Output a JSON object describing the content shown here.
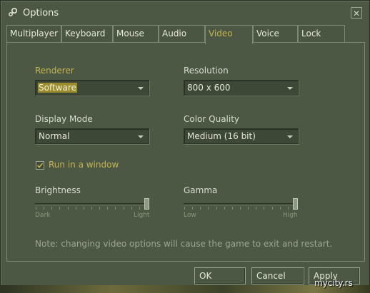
{
  "window": {
    "title": "Options",
    "close_glyph": "✕"
  },
  "tabs": [
    {
      "label": "Multiplayer",
      "active": false
    },
    {
      "label": "Keyboard",
      "active": false
    },
    {
      "label": "Mouse",
      "active": false
    },
    {
      "label": "Audio",
      "active": false
    },
    {
      "label": "Video",
      "active": true
    },
    {
      "label": "Voice",
      "active": false
    },
    {
      "label": "Lock",
      "active": false
    }
  ],
  "video": {
    "renderer": {
      "label": "Renderer",
      "value": "Software"
    },
    "resolution": {
      "label": "Resolution",
      "value": "800 x 600"
    },
    "display_mode": {
      "label": "Display Mode",
      "value": "Normal"
    },
    "color_quality": {
      "label": "Color Quality",
      "value": "Medium (16 bit)"
    },
    "run_in_window": {
      "label": "Run in a window",
      "checked": true
    },
    "brightness": {
      "label": "Brightness",
      "min_label": "Dark",
      "max_label": "Light",
      "value_fraction": 1.0
    },
    "gamma": {
      "label": "Gamma",
      "min_label": "Low",
      "max_label": "High",
      "value_fraction": 1.0
    },
    "note": "Note: changing video options will cause the game to exit and restart."
  },
  "buttons": {
    "ok": "OK",
    "cancel": "Cancel",
    "apply": "Apply"
  },
  "watermark": "mycity.rs",
  "colors": {
    "background": "#4c5844",
    "highlight": "#c4b550"
  }
}
